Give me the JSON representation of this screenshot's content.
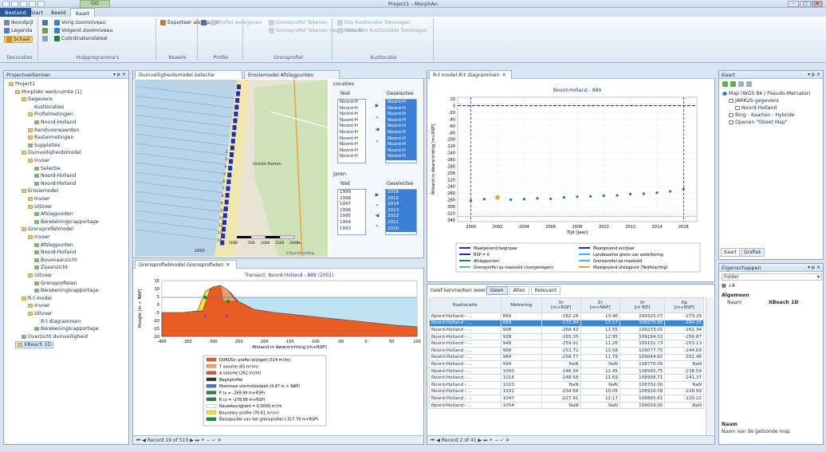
{
  "window": {
    "title": "Project1 - MorphAn",
    "context_tab": "GIS",
    "min": "–",
    "max": "□",
    "close": "✕"
  },
  "ribbon_tabs": [
    {
      "label": "Bestand"
    },
    {
      "label": "Start"
    },
    {
      "label": "Beeld"
    },
    {
      "label": "Kaart"
    }
  ],
  "ribbon": {
    "decoraties": {
      "name": "Decoraties",
      "noordpijl": "Noordpijl",
      "legenda": "Legenda",
      "schaal": "Schaal"
    },
    "hulp": {
      "name": "Hulpprogramma's",
      "vorig": "Vorig zoomniveau",
      "volgend": "Volgend zoomniveau",
      "coord": "Coördinatenstelsel"
    },
    "bewerk": {
      "name": "Bewerk",
      "export": "Exporteer als figuren"
    },
    "profiel": {
      "name": "Profiel",
      "weergeven": "Profiel weergeven"
    },
    "grensprofiel": {
      "name": "Grensprofiel",
      "tekenen": "Grensprofiel Tekenen",
      "auto": "Grensprofiel Tekenen (Automatisch)"
    },
    "kustlocatie": {
      "name": "Kustlocatie",
      "een": "Eén Kustlocatie Toevoegen",
      "meer": "Meerdere Kustlocaties Toevoegen"
    }
  },
  "explorer": {
    "title": "Projectverkenner",
    "pin": "▾ ᵽ ✕",
    "items": [
      {
        "label": "Project1"
      },
      {
        "label": "MorphAn werkruimte (1)"
      },
      {
        "label": "Gegevens"
      },
      {
        "label": "Kustlocaties"
      },
      {
        "label": "Profielmetingen"
      },
      {
        "label": "Noord-Holland"
      },
      {
        "label": "Randvoorwaarden"
      },
      {
        "label": "Rastermetingen"
      },
      {
        "label": "Suppleties"
      },
      {
        "label": "Duinveiligheidsmodel"
      },
      {
        "label": "Invoer"
      },
      {
        "label": "Selectie"
      },
      {
        "label": "Noord-Holland"
      },
      {
        "label": "Noord-Holland"
      },
      {
        "label": "Erosiemodel"
      },
      {
        "label": "Invoer"
      },
      {
        "label": "Uitvoer"
      },
      {
        "label": "Afslagpunten"
      },
      {
        "label": "Berekeningsrapportage"
      },
      {
        "label": "Grensprofielmodel"
      },
      {
        "label": "Invoer"
      },
      {
        "label": "Afslagpunten"
      },
      {
        "label": "Noord-Holland"
      },
      {
        "label": "Bovenaanzicht"
      },
      {
        "label": "Zijaanzicht"
      },
      {
        "label": "Uitvoer"
      },
      {
        "label": "Grensprofielen"
      },
      {
        "label": "Berekeningsrapportage"
      },
      {
        "label": "R-t model"
      },
      {
        "label": "Invoer"
      },
      {
        "label": "Uitvoer"
      },
      {
        "label": "R-t diagrammen"
      },
      {
        "label": "Berekeningsrapportage"
      },
      {
        "label": "Overzicht duinveiligheid"
      },
      {
        "label": "XBeach 1D"
      }
    ]
  },
  "map_doc": {
    "tabs": [
      "Duinveiligheidsmodel.Selectie",
      "Erosiemodel.Afslagpunten"
    ],
    "place_label": "Groote Keeten",
    "scale_labels": [
      "0",
      "500",
      "1000",
      "1500",
      "2000"
    ],
    "scale_unit": "m",
    "scale_left": "500",
    "attribution": "©OpenStreetMap",
    "transect_numbers": [
      "2",
      "3",
      "4",
      "5",
      "6",
      "7",
      "8",
      "9",
      "10",
      "11",
      "12",
      "13",
      "14"
    ],
    "bottom_label": "1000"
  },
  "locaties": {
    "title": "Locaties",
    "niet": "Niet",
    "geselecteerd": "Geselectee",
    "niet_items": [
      "Noord-H",
      "Noord-H",
      "Noord-H",
      "Noord-H",
      "Noord-H",
      "Noord-H",
      "Noord-H",
      "Noord-H",
      "Noord-H",
      "Noord-H"
    ],
    "sel_items": [
      "Noord-H",
      "Noord-H",
      "Noord-H",
      "Noord-H",
      "Noord-H",
      "Noord-H",
      "Noord-H",
      "Noord-H",
      "Noord-H",
      "Noord-H"
    ],
    "jaren": "Jaren",
    "jaren_niet": [
      "1999",
      "1998",
      "1997",
      "1996",
      "1995",
      "1994",
      "1993"
    ],
    "jaren_sel": [
      "2016",
      "2015",
      "2014",
      "2013",
      "2012",
      "2011",
      "2010"
    ]
  },
  "grens_doc": {
    "tab": "Grensprofielmodel.Grensprofielen",
    "chart_data": {
      "type": "line",
      "title": "Transect: Noord-Holland - 889 (2001)",
      "xlabel": "Afstand in dwarsrichting [m+RSP]",
      "ylabel": "Hoogte [m + NAP]",
      "xlim": [
        -400,
        100
      ],
      "ylim": [
        -20,
        15
      ],
      "xticks": [
        "-400",
        "-350",
        "-300",
        "-250",
        "-200",
        "-150",
        "-100",
        "-50",
        "0",
        "50",
        "100"
      ],
      "yticks": [
        "15",
        "10",
        "5",
        "0",
        "-5",
        "-10",
        "-15",
        "-20"
      ]
    },
    "legend": [
      "DUROS+ profiel wijzigen (314 m³/m)",
      "T volume (65 m³/m)",
      "A volume (262 m³/m)",
      "Beginprofiel",
      "Maximaal stormvloedpeil (4.47 m + NAP)",
      "P (x = -269.99 m+RSP)",
      "R (x = -278.58 m+RSP)",
      "Nauwkeurigheid = 0.0009 m³/m",
      "Boundary profile (76.61 m³/m)",
      "Basispositie van het grensprofiel (-317.79 m+RSP)"
    ],
    "status": "Record 19 of 510"
  },
  "rt_doc": {
    "tab": "R-t model.R-t diagrammen",
    "chart_data": {
      "type": "scatter",
      "title": "Noord-Holland - 889",
      "xlabel": "Tijd [jaar]",
      "ylabel": "Afstand in dwarsrichting [m+RSP]",
      "xlim": [
        1999,
        2017
      ],
      "ylim": [
        -345,
        25
      ],
      "xticks": [
        "2000",
        "2002",
        "2004",
        "2006",
        "2008",
        "2010",
        "2012",
        "2014",
        "2016"
      ],
      "yticks": [
        "20",
        "0",
        "-20",
        "-40",
        "-60",
        "-80",
        "-100",
        "-120",
        "-140",
        "-160",
        "-180",
        "-200",
        "-220",
        "-240",
        "-260",
        "-280",
        "-300",
        "-320",
        "-340"
      ],
      "series": [
        {
          "name": "Afslagpunten",
          "x": [
            2000,
            2001,
            2003,
            2004,
            2005,
            2006,
            2007,
            2008,
            2009,
            2010,
            2011,
            2012,
            2013,
            2014,
            2015,
            2016
          ],
          "y": [
            -282,
            -278,
            -280,
            -278,
            -276,
            -277,
            -273,
            -271,
            -270,
            -268,
            -267,
            -263,
            -262,
            -259,
            -255,
            -248
          ]
        },
        {
          "name": "Maatgevend afslagpunt (Twijfelachtig)",
          "x": [
            2002
          ],
          "y": [
            -273
          ]
        }
      ]
    },
    "legend": [
      "Maatgevend beginjaar",
      "Maatgevend eindjaar",
      "RSP = 0",
      "Landwaartse grens van waterkering",
      "Afslagpunten",
      "Grensprofiel op maaiveld",
      "Grensprofiel op maaiveld (overgeslagen)",
      "Maatgevend afslagpunt (Twijfelachtig)"
    ]
  },
  "table": {
    "label": "Geef kenmerken weer",
    "filters": [
      "Geen",
      "Alles",
      "Relevant"
    ],
    "headers": [
      "Kustlocatie",
      "Metrering",
      "Xr\n[m+RSP]",
      "Zr\n[m+NAP]",
      "Xr\n[m RD]",
      "Xp\n[m+RSP]"
    ],
    "rows": [
      [
        "Noord-Holland - ...",
        "869",
        "-282.28",
        "13.46",
        "109325.07",
        "-273.29"
      ],
      [
        "Noord-Holland - ...",
        "889",
        "-272.94",
        "13.17",
        "109279.88",
        "-264.25"
      ],
      [
        "Noord-Holland - ...",
        "908",
        "-268.42",
        "11.55",
        "109233.01",
        "-261.34"
      ],
      [
        "Noord-Holland - ...",
        "928",
        "-265.35",
        "12.95",
        "109184.02",
        "-256.87"
      ],
      [
        "Noord-Holland - ...",
        "948",
        "-259.91",
        "11.26",
        "109131.73",
        "-253.13"
      ],
      [
        "Noord-Holland - ...",
        "968",
        "-253.72",
        "13.58",
        "109077.75",
        "-244.69"
      ],
      [
        "Noord-Holland - ...",
        "984",
        "-258.77",
        "11.79",
        "109044.62",
        "-251.46"
      ],
      [
        "Noord-Holland - ...",
        "994",
        "NaN",
        "NaN",
        "108770.00",
        "NaN"
      ],
      [
        "Noord-Holland - ...",
        "1000",
        "-246.56",
        "12.45",
        "108995.75",
        "-238.59"
      ],
      [
        "Noord-Holland - ...",
        "1016",
        "-248.58",
        "11.69",
        "108958.71",
        "-241.37"
      ],
      [
        "Noord-Holland - ...",
        "1023",
        "NaN",
        "NaN",
        "108702.00",
        "NaN"
      ],
      [
        "Noord-Holland - ...",
        "1031",
        "-234.56",
        "10.05",
        "108910.08",
        "-228.99"
      ],
      [
        "Noord-Holland - ...",
        "1047",
        "-227.91",
        "12.17",
        "108865.61",
        "-220.22"
      ],
      [
        "Noord-Holland - ...",
        "1054",
        "NaN",
        "NaN",
        "108629.00",
        "NaN"
      ]
    ],
    "status": "Record 2 of 41"
  },
  "kaart": {
    "title": "Kaart",
    "items": [
      "Map (WGS 84 / Pseudo-Mercator)",
      "JARKUS-gegevens",
      "Noord-Holland",
      "Bing - Kaarten - Hybride",
      "Openen \"Street Map\""
    ],
    "tabs": [
      "Kaart",
      "Grafiek"
    ]
  },
  "props": {
    "title": "Eigenschappen",
    "folder": "Folder",
    "section": "Algemeen",
    "name_key": "Naam",
    "name_val": "XBeach 1D",
    "desc_title": "Naam",
    "desc": "Naam van de getoonde map."
  }
}
